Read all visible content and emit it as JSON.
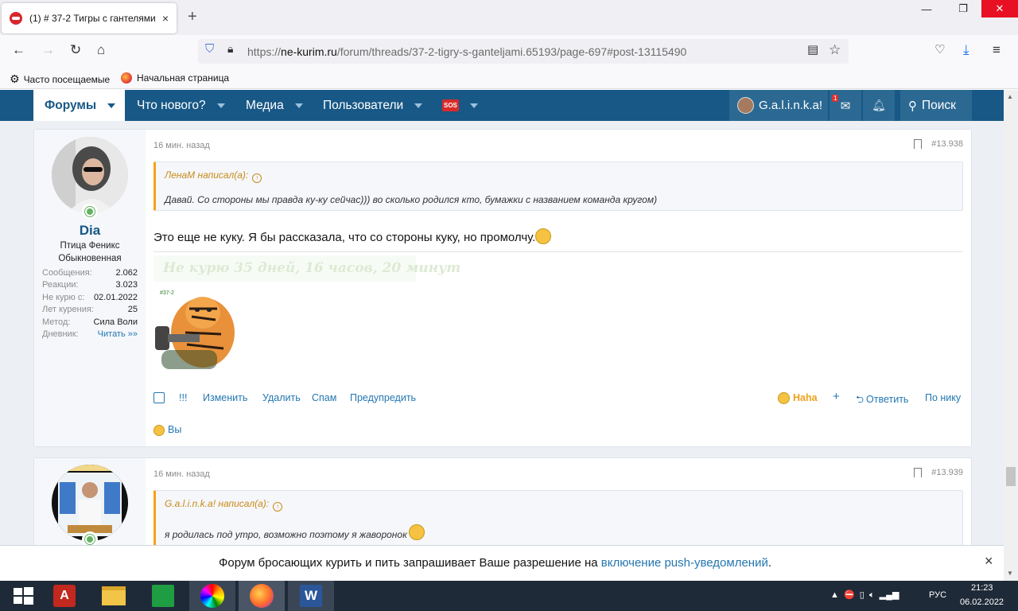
{
  "browser": {
    "tab_title": "(1) # 37-2 Тигры с гантелями |",
    "tab_close": "×",
    "new_tab": "+",
    "url_prefix": "https://",
    "url_domain": "ne-kurim.ru",
    "url_path": "/forum/threads/37-2-tigry-s-ganteljami.65193/page-697#post-13115490",
    "bookmarks": [
      "Часто посещаемые",
      "Начальная страница"
    ]
  },
  "forum_nav": {
    "forums": "Форумы",
    "whats_new": "Что нового?",
    "media": "Медиа",
    "users": "Пользователи",
    "sos": "SOS",
    "username": "G.a.l.i.n.k.a!",
    "mail_badge": "1",
    "search": "Поиск"
  },
  "post1": {
    "author": "Dia",
    "title1": "Птица Феникс",
    "title2": "Обыкновенная",
    "stats": [
      {
        "label": "Сообщения:",
        "value": "2.062"
      },
      {
        "label": "Реакции:",
        "value": "3.023"
      },
      {
        "label": "Не курю с:",
        "value": "02.01.2022"
      },
      {
        "label": "Лет курения:",
        "value": "25"
      },
      {
        "label": "Метод:",
        "value": "Сила Воли"
      },
      {
        "label": "Дневник:",
        "value": "Читать »»"
      }
    ],
    "time": "16 мин. назад",
    "number": "#13.938",
    "quote_author": "ЛенаМ написал(а):",
    "quote_text": "Давай. Со стороны мы правда ку-ку сейчас))) во сколько родился кто, бумажки с названием команда кругом)",
    "text": "Это еще не куку. Я бы рассказала, что со стороны куку, но промолчу.",
    "signature": "Не курю  35 дней, 16 часов, 20 минут",
    "actions": [
      "!!!",
      "Изменить",
      "Удалить",
      "Спам",
      "Предупредить"
    ],
    "reaction": "Haha",
    "reply": "Ответить",
    "by_nick": "По нику",
    "reacted_by": "Вы"
  },
  "post2": {
    "time": "16 мин. назад",
    "number": "#13.939",
    "quote_author": "G.a.l.i.n.k.a! написал(а):",
    "quote_text": "я родилась под утро, возможно поэтому я жаворонок"
  },
  "push": {
    "text": "Форум бросающих курить и пить запрашивает Ваше разрешение на",
    "link": "включение push-уведомлений",
    "end": ".",
    "close": "×"
  },
  "taskbar": {
    "lang": "РУС",
    "time": "21:23",
    "date": "06.02.2022"
  }
}
